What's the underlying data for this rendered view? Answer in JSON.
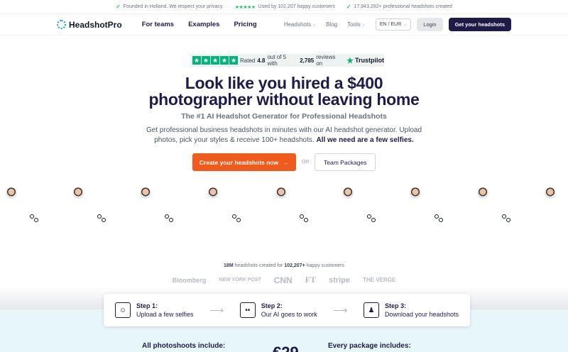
{
  "topbar": {
    "item1": "Founded in Holland. We respect your privacy.",
    "item2": "Used by 102,207 happy customers",
    "item3": "17,943,292+ professional headshots created"
  },
  "nav": {
    "brand": "HeadshotPro",
    "links": [
      "For teams",
      "Examples",
      "Pricing"
    ],
    "headshots": "Headshots",
    "blog": "Blog",
    "tools": "Tools",
    "lang": "EN / EUR",
    "login": "Login",
    "cta": "Get your headshots"
  },
  "trustpilot": {
    "prefix": "Rated",
    "rating": "4.8",
    "middle": "out of 5 with",
    "reviews": "2,785",
    "suffix": "reviews on",
    "brand": "Trustpilot"
  },
  "hero": {
    "headline_1": "Look like you hired a $400",
    "headline_2": "photographer without leaving home",
    "subhead": "The #1 AI Headshot Generator for Professional Headshots",
    "desc": "Get professional business headshots in minutes with our AI headshot generator. Upload photos, pick your styles & receive 100+ headshots.",
    "desc_bold": "All we need are a few selfies.",
    "cta_main": "Create your headshots now",
    "or": "OR",
    "cta_secondary": "Team Packages"
  },
  "social": {
    "count": "18M",
    "text1": "headshots created for",
    "customers": "102,207+",
    "text2": "happy customers",
    "logos": [
      "Bloomberg",
      "NEW YORK POST",
      "CNN",
      "FT",
      "stripe",
      "THE VERGE"
    ]
  },
  "steps": [
    {
      "title": "Step 1:",
      "text": "Upload a few selfies",
      "icon": "selfie-icon"
    },
    {
      "title": "Step 2:",
      "text": "Our AI goes to work",
      "icon": "ai-icon"
    },
    {
      "title": "Step 3:",
      "text": "Download your headshots",
      "icon": "portrait-icon"
    }
  ],
  "bottom": {
    "left": "All photoshoots include:",
    "price": "€29",
    "right": "Every package includes:"
  }
}
